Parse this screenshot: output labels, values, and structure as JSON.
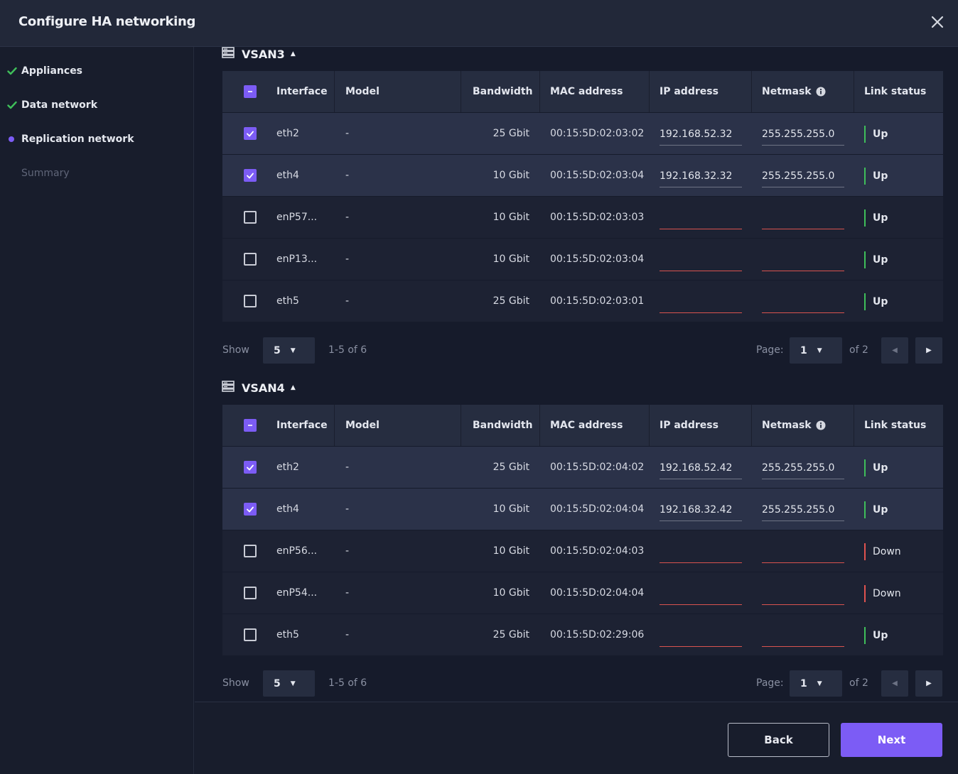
{
  "dialog": {
    "title": "Configure HA networking"
  },
  "steps": [
    {
      "label": "Appliances",
      "state": "done"
    },
    {
      "label": "Data network",
      "state": "done"
    },
    {
      "label": "Replication network",
      "state": "current"
    },
    {
      "label": "Summary",
      "state": "pending"
    }
  ],
  "columns": {
    "interface": "Interface",
    "model": "Model",
    "bandwidth": "Bandwidth",
    "mac": "MAC address",
    "ip": "IP address",
    "netmask": "Netmask",
    "link": "Link status"
  },
  "sections": [
    {
      "name": "VSAN3",
      "rows": [
        {
          "checked": true,
          "interface": "eth2",
          "model": "-",
          "bandwidth": "25 Gbit",
          "mac": "00:15:5D:02:03:02",
          "ip": "192.168.52.32",
          "netmask": "255.255.255.0",
          "link": "Up"
        },
        {
          "checked": true,
          "interface": "eth4",
          "model": "-",
          "bandwidth": "10 Gbit",
          "mac": "00:15:5D:02:03:04",
          "ip": "192.168.32.32",
          "netmask": "255.255.255.0",
          "link": "Up"
        },
        {
          "checked": false,
          "interface": "enP57...",
          "model": "-",
          "bandwidth": "10 Gbit",
          "mac": "00:15:5D:02:03:03",
          "ip": "",
          "netmask": "",
          "link": "Up"
        },
        {
          "checked": false,
          "interface": "enP13...",
          "model": "-",
          "bandwidth": "10 Gbit",
          "mac": "00:15:5D:02:03:04",
          "ip": "",
          "netmask": "",
          "link": "Up"
        },
        {
          "checked": false,
          "interface": "eth5",
          "model": "-",
          "bandwidth": "25 Gbit",
          "mac": "00:15:5D:02:03:01",
          "ip": "",
          "netmask": "",
          "link": "Up"
        }
      ],
      "pager": {
        "show_label": "Show",
        "page_size": "5",
        "range": "1-5 of 6",
        "page_label": "Page:",
        "page": "1",
        "of_pages": "of 2"
      }
    },
    {
      "name": "VSAN4",
      "rows": [
        {
          "checked": true,
          "interface": "eth2",
          "model": "-",
          "bandwidth": "25 Gbit",
          "mac": "00:15:5D:02:04:02",
          "ip": "192.168.52.42",
          "netmask": "255.255.255.0",
          "link": "Up"
        },
        {
          "checked": true,
          "interface": "eth4",
          "model": "-",
          "bandwidth": "10 Gbit",
          "mac": "00:15:5D:02:04:04",
          "ip": "192.168.32.42",
          "netmask": "255.255.255.0",
          "link": "Up"
        },
        {
          "checked": false,
          "interface": "enP56...",
          "model": "-",
          "bandwidth": "10 Gbit",
          "mac": "00:15:5D:02:04:03",
          "ip": "",
          "netmask": "",
          "link": "Down"
        },
        {
          "checked": false,
          "interface": "enP54...",
          "model": "-",
          "bandwidth": "10 Gbit",
          "mac": "00:15:5D:02:04:04",
          "ip": "",
          "netmask": "",
          "link": "Down"
        },
        {
          "checked": false,
          "interface": "eth5",
          "model": "-",
          "bandwidth": "25 Gbit",
          "mac": "00:15:5D:02:29:06",
          "ip": "",
          "netmask": "",
          "link": "Up"
        }
      ],
      "pager": {
        "show_label": "Show",
        "page_size": "5",
        "range": "1-5 of 6",
        "page_label": "Page:",
        "page": "1",
        "of_pages": "of 2"
      }
    }
  ],
  "footer": {
    "back_label": "Back",
    "next_label": "Next"
  },
  "colors": {
    "accent": "#7c5cf5",
    "status_up": "#3fbf5a",
    "status_down": "#e0534f",
    "error_underline": "#d9534f"
  },
  "icons": {
    "close": "close-icon",
    "check": "check-icon",
    "server": "server-icon",
    "info": "info-icon",
    "caret_up": "caret-up-icon",
    "caret_down": "caret-down-icon",
    "prev": "prev-page-icon",
    "next": "next-page-icon"
  }
}
